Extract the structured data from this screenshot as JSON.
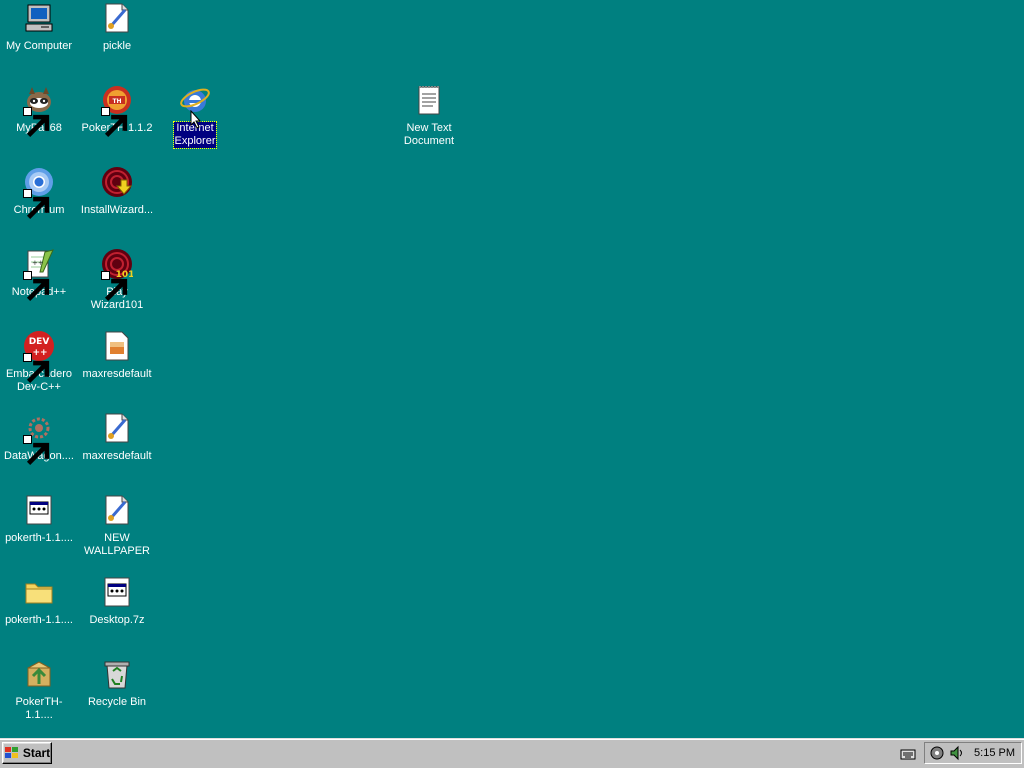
{
  "desktop": {
    "background_color": "#008080",
    "icons": [
      {
        "label": "My Computer",
        "icon": "my-computer-icon",
        "shortcut": false
      },
      {
        "label": "pickle",
        "icon": "paint-document-icon",
        "shortcut": false
      },
      {
        "label": "MyPal 68",
        "icon": "mypal-icon",
        "shortcut": true
      },
      {
        "label": "PokerTH 1.1.2",
        "icon": "pokerth-icon",
        "shortcut": true
      },
      {
        "label": "Internet\nExplorer",
        "icon": "internet-explorer-icon",
        "shortcut": false,
        "selected": true
      },
      {
        "label": "New Text\nDocument",
        "icon": "text-document-icon",
        "shortcut": false
      },
      {
        "label": "Chromium",
        "icon": "chromium-icon",
        "shortcut": true
      },
      {
        "label": "InstallWizard...",
        "icon": "install-wizard-icon",
        "shortcut": false
      },
      {
        "label": "Notepad++",
        "icon": "notepadpp-icon",
        "shortcut": true
      },
      {
        "label": "Play Wizard101",
        "icon": "wizard101-icon",
        "shortcut": true
      },
      {
        "label": "Embarcadero\nDev-C++",
        "icon": "devcpp-icon",
        "shortcut": true
      },
      {
        "label": "maxresdefault",
        "icon": "image-file-icon",
        "shortcut": false
      },
      {
        "label": "DataWagon....",
        "icon": "datawagon-icon",
        "shortcut": true
      },
      {
        "label": "maxresdefault",
        "icon": "paint-document-icon",
        "shortcut": false
      },
      {
        "label": "pokerth-1.1....",
        "icon": "executable-icon",
        "shortcut": false
      },
      {
        "label": "NEW\nWALLPAPER",
        "icon": "paint-document-icon",
        "shortcut": false
      },
      {
        "label": "pokerth-1.1....",
        "icon": "folder-icon",
        "shortcut": false
      },
      {
        "label": "Desktop.7z",
        "icon": "archive-icon",
        "shortcut": false
      },
      {
        "label": "PokerTH-1.1....",
        "icon": "package-icon",
        "shortcut": false
      },
      {
        "label": "Recycle Bin",
        "icon": "recycle-bin-icon",
        "shortcut": false
      }
    ]
  },
  "taskbar": {
    "start_label": "Start",
    "clock": "5:15 PM",
    "tray_icons": [
      "keyboard-icon",
      "network-icon",
      "volume-icon"
    ]
  }
}
